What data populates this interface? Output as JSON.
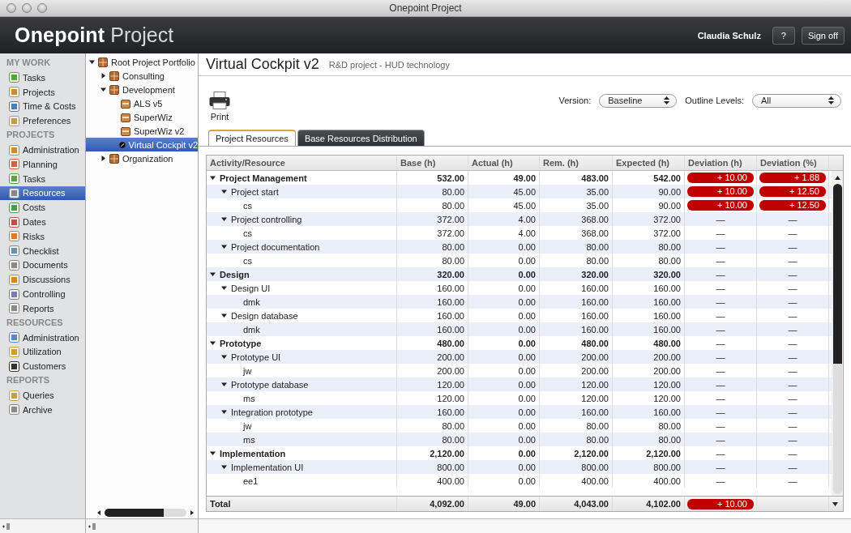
{
  "window": {
    "title": "Onepoint Project"
  },
  "header": {
    "logo_brand": "Onepoint",
    "logo_product": "Project",
    "user": "Claudia Schulz",
    "buttons": [
      "?",
      "Sign off"
    ]
  },
  "sidebar": {
    "sections": [
      {
        "title": "MY WORK",
        "items": [
          {
            "label": "Tasks",
            "selected": false
          },
          {
            "label": "Projects",
            "selected": false
          },
          {
            "label": "Time & Costs",
            "selected": false
          },
          {
            "label": "Preferences",
            "selected": false
          }
        ]
      },
      {
        "title": "PROJECTS",
        "items": [
          {
            "label": "Administration",
            "selected": false
          },
          {
            "label": "Planning",
            "selected": false
          },
          {
            "label": "Tasks",
            "selected": false
          },
          {
            "label": "Resources",
            "selected": true
          },
          {
            "label": "Costs",
            "selected": false
          },
          {
            "label": "Dates",
            "selected": false
          },
          {
            "label": "Risks",
            "selected": false
          },
          {
            "label": "Checklist",
            "selected": false
          },
          {
            "label": "Documents",
            "selected": false
          },
          {
            "label": "Discussions",
            "selected": false
          },
          {
            "label": "Controlling",
            "selected": false
          },
          {
            "label": "Reports",
            "selected": false
          }
        ]
      },
      {
        "title": "RESOURCES",
        "items": [
          {
            "label": "Administration",
            "selected": false
          },
          {
            "label": "Utilization",
            "selected": false
          },
          {
            "label": "Customers",
            "selected": false
          }
        ]
      },
      {
        "title": "REPORTS",
        "items": [
          {
            "label": "Queries",
            "selected": false
          },
          {
            "label": "Archive",
            "selected": false
          }
        ]
      }
    ]
  },
  "project_tree": {
    "items": [
      {
        "label": "Root Project Portfolio",
        "kind": "portfolio",
        "expanded": true,
        "selected": false,
        "children": [
          {
            "label": "Consulting",
            "kind": "portfolio",
            "expanded": false,
            "selected": false
          },
          {
            "label": "Development",
            "kind": "portfolio",
            "expanded": true,
            "selected": false,
            "children": [
              {
                "label": "ALS v5",
                "kind": "project",
                "selected": false
              },
              {
                "label": "SuperWiz",
                "kind": "project",
                "selected": false
              },
              {
                "label": "SuperWiz v2",
                "kind": "project",
                "selected": false
              },
              {
                "label": "Virtual Cockpit v2",
                "kind": "program",
                "selected": true
              }
            ]
          },
          {
            "label": "Organization",
            "kind": "portfolio",
            "expanded": false,
            "selected": false
          }
        ]
      }
    ]
  },
  "page": {
    "title": "Virtual Cockpit v2",
    "subtitle": "R&D project - HUD technology"
  },
  "toolbar": {
    "print": "Print",
    "version_label": "Version:",
    "version": "Baseline",
    "outline_label": "Outline Levels:",
    "outline": "All"
  },
  "tabs": [
    {
      "label": "Project Resources",
      "selected": true
    },
    {
      "label": "Base Resources Distribution",
      "selected": false
    }
  ],
  "table": {
    "columns": [
      "Activity/Resource",
      "Base (h)",
      "Actual (h)",
      "Rem. (h)",
      "Expected (h)",
      "Deviation (h)",
      "Deviation (%)"
    ],
    "rows": [
      {
        "name": "Project Management",
        "base": "532.00",
        "actual": "49.00",
        "rem": "483.00",
        "expected": "542.00",
        "dev_h": {
          "value": "+ 10.00",
          "flagged": true
        },
        "dev_pct": {
          "value": "+ 1.88",
          "flagged": true
        },
        "expanded": true,
        "children": [
          {
            "name": "Project start",
            "base": "80.00",
            "actual": "45.00",
            "rem": "35.00",
            "expected": "90.00",
            "dev_h": {
              "value": "+ 10.00",
              "flagged": true
            },
            "dev_pct": {
              "value": "+ 12.50",
              "flagged": true
            },
            "expanded": true,
            "children": [
              {
                "name": "cs",
                "base": "80.00",
                "actual": "45.00",
                "rem": "35.00",
                "expected": "90.00",
                "dev_h": {
                  "value": "+ 10.00",
                  "flagged": true
                },
                "dev_pct": {
                  "value": "+ 12.50",
                  "flagged": true
                }
              }
            ]
          },
          {
            "name": "Project controlling",
            "base": "372.00",
            "actual": "4.00",
            "rem": "368.00",
            "expected": "372.00",
            "dev_h": {
              "value": "—",
              "flagged": false
            },
            "dev_pct": {
              "value": "—",
              "flagged": false
            },
            "expanded": true,
            "children": [
              {
                "name": "cs",
                "base": "372.00",
                "actual": "4.00",
                "rem": "368.00",
                "expected": "372.00",
                "dev_h": {
                  "value": "—",
                  "flagged": false
                },
                "dev_pct": {
                  "value": "—",
                  "flagged": false
                }
              }
            ]
          },
          {
            "name": "Project documentation",
            "base": "80.00",
            "actual": "0.00",
            "rem": "80.00",
            "expected": "80.00",
            "dev_h": {
              "value": "—",
              "flagged": false
            },
            "dev_pct": {
              "value": "—",
              "flagged": false
            },
            "expanded": true,
            "children": [
              {
                "name": "cs",
                "base": "80.00",
                "actual": "0.00",
                "rem": "80.00",
                "expected": "80.00",
                "dev_h": {
                  "value": "—",
                  "flagged": false
                },
                "dev_pct": {
                  "value": "—",
                  "flagged": false
                }
              }
            ]
          }
        ]
      },
      {
        "name": "Design",
        "base": "320.00",
        "actual": "0.00",
        "rem": "320.00",
        "expected": "320.00",
        "dev_h": {
          "value": "—",
          "flagged": false
        },
        "dev_pct": {
          "value": "—",
          "flagged": false
        },
        "expanded": true,
        "children": [
          {
            "name": "Design UI",
            "base": "160.00",
            "actual": "0.00",
            "rem": "160.00",
            "expected": "160.00",
            "dev_h": {
              "value": "—",
              "flagged": false
            },
            "dev_pct": {
              "value": "—",
              "flagged": false
            },
            "expanded": true,
            "children": [
              {
                "name": "dmk",
                "base": "160.00",
                "actual": "0.00",
                "rem": "160.00",
                "expected": "160.00",
                "dev_h": {
                  "value": "—",
                  "flagged": false
                },
                "dev_pct": {
                  "value": "—",
                  "flagged": false
                }
              }
            ]
          },
          {
            "name": "Design database",
            "base": "160.00",
            "actual": "0.00",
            "rem": "160.00",
            "expected": "160.00",
            "dev_h": {
              "value": "—",
              "flagged": false
            },
            "dev_pct": {
              "value": "—",
              "flagged": false
            },
            "expanded": true,
            "children": [
              {
                "name": "dmk",
                "base": "160.00",
                "actual": "0.00",
                "rem": "160.00",
                "expected": "160.00",
                "dev_h": {
                  "value": "—",
                  "flagged": false
                },
                "dev_pct": {
                  "value": "—",
                  "flagged": false
                }
              }
            ]
          }
        ]
      },
      {
        "name": "Prototype",
        "base": "480.00",
        "actual": "0.00",
        "rem": "480.00",
        "expected": "480.00",
        "dev_h": {
          "value": "—",
          "flagged": false
        },
        "dev_pct": {
          "value": "—",
          "flagged": false
        },
        "expanded": true,
        "children": [
          {
            "name": "Prototype UI",
            "base": "200.00",
            "actual": "0.00",
            "rem": "200.00",
            "expected": "200.00",
            "dev_h": {
              "value": "—",
              "flagged": false
            },
            "dev_pct": {
              "value": "—",
              "flagged": false
            },
            "expanded": true,
            "children": [
              {
                "name": "jw",
                "base": "200.00",
                "actual": "0.00",
                "rem": "200.00",
                "expected": "200.00",
                "dev_h": {
                  "value": "—",
                  "flagged": false
                },
                "dev_pct": {
                  "value": "—",
                  "flagged": false
                }
              }
            ]
          },
          {
            "name": "Prototype database",
            "base": "120.00",
            "actual": "0.00",
            "rem": "120.00",
            "expected": "120.00",
            "dev_h": {
              "value": "—",
              "flagged": false
            },
            "dev_pct": {
              "value": "—",
              "flagged": false
            },
            "expanded": true,
            "children": [
              {
                "name": "ms",
                "base": "120.00",
                "actual": "0.00",
                "rem": "120.00",
                "expected": "120.00",
                "dev_h": {
                  "value": "—",
                  "flagged": false
                },
                "dev_pct": {
                  "value": "—",
                  "flagged": false
                }
              }
            ]
          },
          {
            "name": "Integration prototype",
            "base": "160.00",
            "actual": "0.00",
            "rem": "160.00",
            "expected": "160.00",
            "dev_h": {
              "value": "—",
              "flagged": false
            },
            "dev_pct": {
              "value": "—",
              "flagged": false
            },
            "expanded": true,
            "children": [
              {
                "name": "jw",
                "base": "80.00",
                "actual": "0.00",
                "rem": "80.00",
                "expected": "80.00",
                "dev_h": {
                  "value": "—",
                  "flagged": false
                },
                "dev_pct": {
                  "value": "—",
                  "flagged": false
                }
              },
              {
                "name": "ms",
                "base": "80.00",
                "actual": "0.00",
                "rem": "80.00",
                "expected": "80.00",
                "dev_h": {
                  "value": "—",
                  "flagged": false
                },
                "dev_pct": {
                  "value": "—",
                  "flagged": false
                }
              }
            ]
          }
        ]
      },
      {
        "name": "Implementation",
        "base": "2,120.00",
        "actual": "0.00",
        "rem": "2,120.00",
        "expected": "2,120.00",
        "dev_h": {
          "value": "—",
          "flagged": false
        },
        "dev_pct": {
          "value": "—",
          "flagged": false
        },
        "expanded": true,
        "children": [
          {
            "name": "Implementation UI",
            "base": "800.00",
            "actual": "0.00",
            "rem": "800.00",
            "expected": "800.00",
            "dev_h": {
              "value": "—",
              "flagged": false
            },
            "dev_pct": {
              "value": "—",
              "flagged": false
            },
            "expanded": true,
            "children": [
              {
                "name": "ee1",
                "base": "400.00",
                "actual": "0.00",
                "rem": "400.00",
                "expected": "400.00",
                "dev_h": {
                  "value": "—",
                  "flagged": false
                },
                "dev_pct": {
                  "value": "—",
                  "flagged": false
                }
              }
            ]
          }
        ]
      }
    ],
    "total": {
      "name": "Total",
      "base": "4,092.00",
      "actual": "49.00",
      "rem": "4,043.00",
      "expected": "4,102.00",
      "dev_h": {
        "value": "+ 10.00",
        "flagged": true
      }
    }
  }
}
